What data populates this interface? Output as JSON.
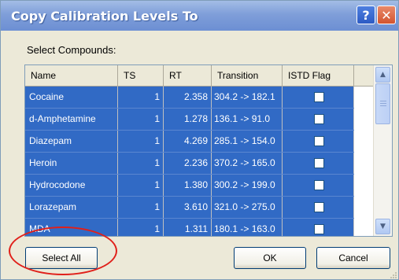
{
  "dialog": {
    "title": "Copy Calibration Levels To",
    "help_glyph": "?",
    "close_glyph": "✕",
    "select_label": "Select Compounds:"
  },
  "grid": {
    "columns": [
      "Name",
      "TS",
      "RT",
      "Transition",
      "ISTD Flag"
    ],
    "rows": [
      {
        "name": "Cocaine",
        "ts": "1",
        "rt": "2.358",
        "transition": "304.2 -> 182.1",
        "istd": false
      },
      {
        "name": "d-Amphetamine",
        "ts": "1",
        "rt": "1.278",
        "transition": "136.1 -> 91.0",
        "istd": false
      },
      {
        "name": "Diazepam",
        "ts": "1",
        "rt": "4.269",
        "transition": "285.1 -> 154.0",
        "istd": false
      },
      {
        "name": "Heroin",
        "ts": "1",
        "rt": "2.236",
        "transition": "370.2 -> 165.0",
        "istd": false
      },
      {
        "name": "Hydrocodone",
        "ts": "1",
        "rt": "1.380",
        "transition": "300.2 -> 199.0",
        "istd": false
      },
      {
        "name": "Lorazepam",
        "ts": "1",
        "rt": "3.610",
        "transition": "321.0 -> 275.0",
        "istd": false
      },
      {
        "name": "MDA",
        "ts": "1",
        "rt": "1.311",
        "transition": "180.1 -> 163.0",
        "istd": false
      }
    ],
    "selection_color": "#316ac5"
  },
  "buttons": {
    "select_all": "Select All",
    "ok": "OK",
    "cancel": "Cancel"
  },
  "colors": {
    "title_bar": "#7f9ed9",
    "dialog_bg": "#ece9d8",
    "highlight_circle": "#e0201a"
  },
  "icons": [
    "help-icon",
    "close-icon",
    "scroll-up-arrow-icon",
    "scroll-down-arrow-icon",
    "checkbox-icon"
  ]
}
